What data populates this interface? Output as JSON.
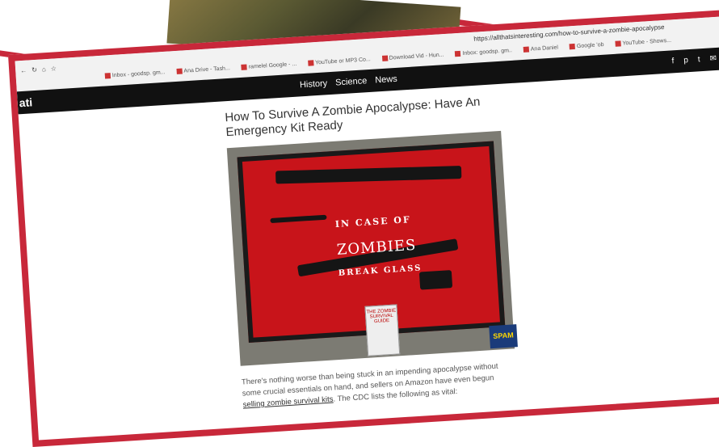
{
  "browser": {
    "address": "https://allthatsinteresting.com/how-to-survive-a-zombie-apocalypse",
    "bookmarks": [
      "Inbox - goodsp. gm...",
      "Ana Drive - Tash...",
      "ramelel Google - ...",
      "YouTube or MP3 Co...",
      "Download Vid - Hun...",
      "Inbox: goodsp. gm..",
      "Ana Daniel",
      "Google 'ob",
      "YouTube - Shows..."
    ]
  },
  "site": {
    "logo": "ati",
    "nav": [
      "History",
      "Science",
      "News"
    ],
    "social": [
      "f",
      "p",
      "t",
      "✉"
    ]
  },
  "article": {
    "title": "How To Survive A Zombie Apocalypse: Have An Emergency Kit Ready",
    "image": {
      "line1": "IN CASE OF",
      "line2": "ZOMBIES",
      "line3": "BREAK GLASS",
      "book": "THE ZOMBIE SURVIVAL GUIDE",
      "can": "SPAM"
    },
    "body_start": "There's nothing worse than being stuck in an impending apocalypse without some crucial essentials on hand, and sellers on Amazon have even begun",
    "link": "selling zombie survival kits",
    "body_end": ". The CDC lists the following as vital:"
  },
  "colors": {
    "frame": "#c8283a",
    "navbar": "#111111"
  }
}
